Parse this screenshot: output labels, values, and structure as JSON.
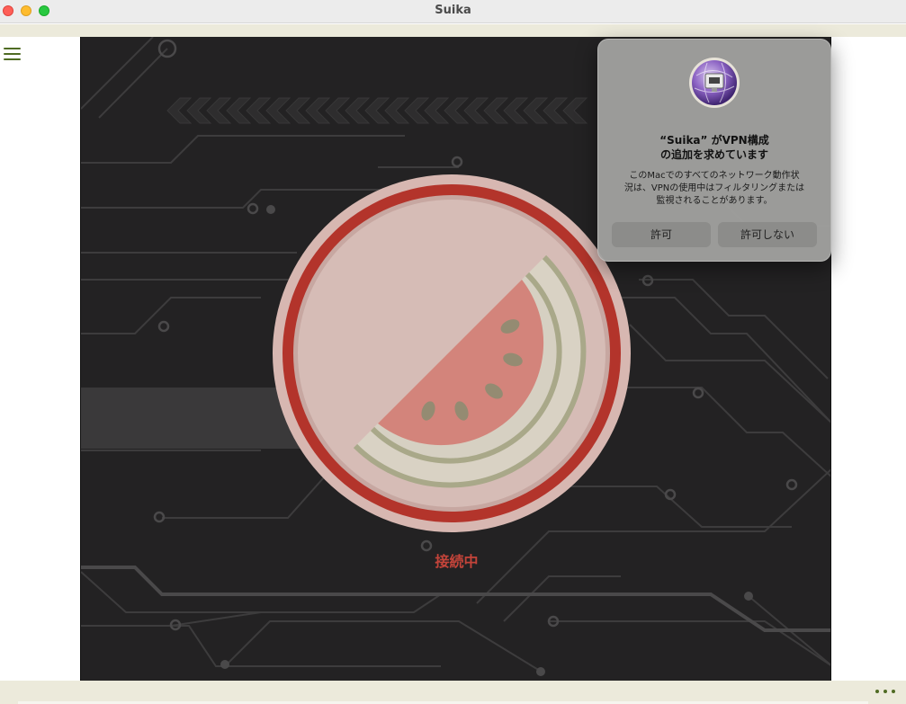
{
  "window": {
    "title": "Suika"
  },
  "icons": {
    "menu": "hamburger-menu-icon",
    "more": "ellipsis-icon",
    "logo": "watermelon-logo-icon",
    "vpn": "vpn-network-icon"
  },
  "status": {
    "label": "接続中"
  },
  "vpn_dialog": {
    "title_line1": "“Suika” がVPN構成",
    "title_line2": "の追加を求めています",
    "body_line1": "このMacでのすべてのネットワーク動作状",
    "body_line2": "況は、VPNの使用中はフィルタリングまたは",
    "body_line3": "監視されることがあります。",
    "allow_label": "許可",
    "deny_label": "許可しない"
  },
  "colors": {
    "accent": "#4f6b23",
    "status": "#c4443a",
    "stage_bg": "#232223",
    "ring_red": "#c0392e",
    "melon_flesh": "#d3847b"
  }
}
